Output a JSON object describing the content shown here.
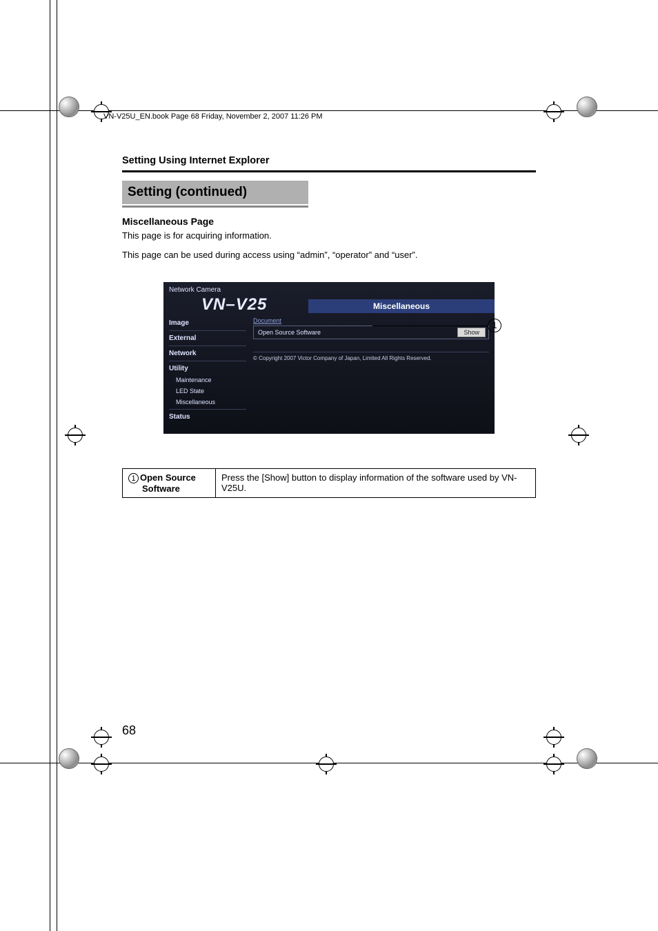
{
  "print_header": "VN-V25U_EN.book  Page 68  Friday, November 2, 2007  11:26 PM",
  "breadcrumb": "Setting Using Internet Explorer",
  "section_title": "Setting (continued)",
  "subhead": "Miscellaneous Page",
  "para1": "This page is for acquiring information.",
  "para2": "This page can be used during access using “admin”, “operator” and “user”.",
  "screenshot": {
    "brand": "Network Camera",
    "model": "VN–V25",
    "title": "Miscellaneous",
    "nav": {
      "image": "Image",
      "external": "External",
      "network": "Network",
      "utility": "Utility",
      "maintenance": "Maintenance",
      "led_state": "LED State",
      "miscellaneous": "Miscellaneous",
      "status": "Status"
    },
    "doc_label": "Document",
    "row_label": "Open Source Software",
    "show_btn": "Show",
    "copyright": "© Copyright 2007 Victor Company of Japan, Limited All Rights Reserved."
  },
  "callout": "1",
  "table": {
    "num": "1",
    "label_l1": "Open Source",
    "label_l2": "Software",
    "desc": "Press the [Show] button to display information of the software used by VN-V25U."
  },
  "page_number": "68"
}
